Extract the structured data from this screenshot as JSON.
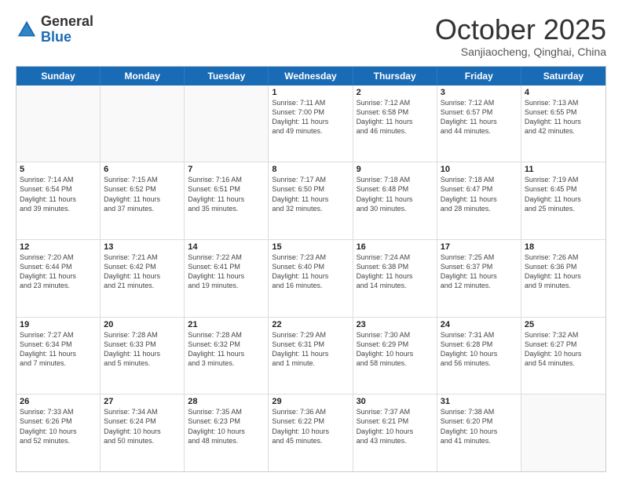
{
  "logo": {
    "general": "General",
    "blue": "Blue"
  },
  "header": {
    "month": "October 2025",
    "location": "Sanjiaocheng, Qinghai, China"
  },
  "days": [
    "Sunday",
    "Monday",
    "Tuesday",
    "Wednesday",
    "Thursday",
    "Friday",
    "Saturday"
  ],
  "rows": [
    [
      {
        "day": "",
        "info": ""
      },
      {
        "day": "",
        "info": ""
      },
      {
        "day": "",
        "info": ""
      },
      {
        "day": "1",
        "info": "Sunrise: 7:11 AM\nSunset: 7:00 PM\nDaylight: 11 hours\nand 49 minutes."
      },
      {
        "day": "2",
        "info": "Sunrise: 7:12 AM\nSunset: 6:58 PM\nDaylight: 11 hours\nand 46 minutes."
      },
      {
        "day": "3",
        "info": "Sunrise: 7:12 AM\nSunset: 6:57 PM\nDaylight: 11 hours\nand 44 minutes."
      },
      {
        "day": "4",
        "info": "Sunrise: 7:13 AM\nSunset: 6:55 PM\nDaylight: 11 hours\nand 42 minutes."
      }
    ],
    [
      {
        "day": "5",
        "info": "Sunrise: 7:14 AM\nSunset: 6:54 PM\nDaylight: 11 hours\nand 39 minutes."
      },
      {
        "day": "6",
        "info": "Sunrise: 7:15 AM\nSunset: 6:52 PM\nDaylight: 11 hours\nand 37 minutes."
      },
      {
        "day": "7",
        "info": "Sunrise: 7:16 AM\nSunset: 6:51 PM\nDaylight: 11 hours\nand 35 minutes."
      },
      {
        "day": "8",
        "info": "Sunrise: 7:17 AM\nSunset: 6:50 PM\nDaylight: 11 hours\nand 32 minutes."
      },
      {
        "day": "9",
        "info": "Sunrise: 7:18 AM\nSunset: 6:48 PM\nDaylight: 11 hours\nand 30 minutes."
      },
      {
        "day": "10",
        "info": "Sunrise: 7:18 AM\nSunset: 6:47 PM\nDaylight: 11 hours\nand 28 minutes."
      },
      {
        "day": "11",
        "info": "Sunrise: 7:19 AM\nSunset: 6:45 PM\nDaylight: 11 hours\nand 25 minutes."
      }
    ],
    [
      {
        "day": "12",
        "info": "Sunrise: 7:20 AM\nSunset: 6:44 PM\nDaylight: 11 hours\nand 23 minutes."
      },
      {
        "day": "13",
        "info": "Sunrise: 7:21 AM\nSunset: 6:42 PM\nDaylight: 11 hours\nand 21 minutes."
      },
      {
        "day": "14",
        "info": "Sunrise: 7:22 AM\nSunset: 6:41 PM\nDaylight: 11 hours\nand 19 minutes."
      },
      {
        "day": "15",
        "info": "Sunrise: 7:23 AM\nSunset: 6:40 PM\nDaylight: 11 hours\nand 16 minutes."
      },
      {
        "day": "16",
        "info": "Sunrise: 7:24 AM\nSunset: 6:38 PM\nDaylight: 11 hours\nand 14 minutes."
      },
      {
        "day": "17",
        "info": "Sunrise: 7:25 AM\nSunset: 6:37 PM\nDaylight: 11 hours\nand 12 minutes."
      },
      {
        "day": "18",
        "info": "Sunrise: 7:26 AM\nSunset: 6:36 PM\nDaylight: 11 hours\nand 9 minutes."
      }
    ],
    [
      {
        "day": "19",
        "info": "Sunrise: 7:27 AM\nSunset: 6:34 PM\nDaylight: 11 hours\nand 7 minutes."
      },
      {
        "day": "20",
        "info": "Sunrise: 7:28 AM\nSunset: 6:33 PM\nDaylight: 11 hours\nand 5 minutes."
      },
      {
        "day": "21",
        "info": "Sunrise: 7:28 AM\nSunset: 6:32 PM\nDaylight: 11 hours\nand 3 minutes."
      },
      {
        "day": "22",
        "info": "Sunrise: 7:29 AM\nSunset: 6:31 PM\nDaylight: 11 hours\nand 1 minute."
      },
      {
        "day": "23",
        "info": "Sunrise: 7:30 AM\nSunset: 6:29 PM\nDaylight: 10 hours\nand 58 minutes."
      },
      {
        "day": "24",
        "info": "Sunrise: 7:31 AM\nSunset: 6:28 PM\nDaylight: 10 hours\nand 56 minutes."
      },
      {
        "day": "25",
        "info": "Sunrise: 7:32 AM\nSunset: 6:27 PM\nDaylight: 10 hours\nand 54 minutes."
      }
    ],
    [
      {
        "day": "26",
        "info": "Sunrise: 7:33 AM\nSunset: 6:26 PM\nDaylight: 10 hours\nand 52 minutes."
      },
      {
        "day": "27",
        "info": "Sunrise: 7:34 AM\nSunset: 6:24 PM\nDaylight: 10 hours\nand 50 minutes."
      },
      {
        "day": "28",
        "info": "Sunrise: 7:35 AM\nSunset: 6:23 PM\nDaylight: 10 hours\nand 48 minutes."
      },
      {
        "day": "29",
        "info": "Sunrise: 7:36 AM\nSunset: 6:22 PM\nDaylight: 10 hours\nand 45 minutes."
      },
      {
        "day": "30",
        "info": "Sunrise: 7:37 AM\nSunset: 6:21 PM\nDaylight: 10 hours\nand 43 minutes."
      },
      {
        "day": "31",
        "info": "Sunrise: 7:38 AM\nSunset: 6:20 PM\nDaylight: 10 hours\nand 41 minutes."
      },
      {
        "day": "",
        "info": ""
      }
    ]
  ]
}
